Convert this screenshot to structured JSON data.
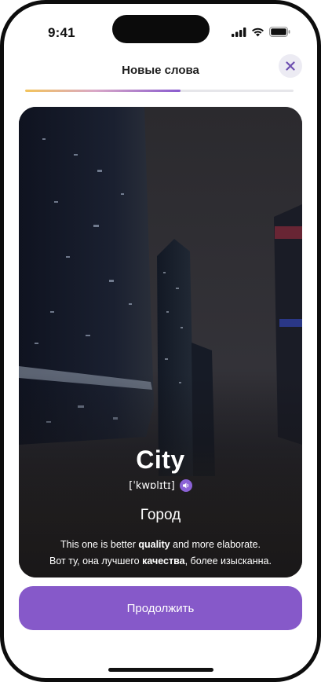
{
  "status_bar": {
    "time": "9:41",
    "icons": [
      "cellular-signal-icon",
      "wifi-icon",
      "battery-icon"
    ]
  },
  "header": {
    "title": "Новые слова",
    "close_icon": "close-icon"
  },
  "progress": {
    "fraction": 0.58,
    "gradient": [
      "#f3c45b",
      "#d9a8c7",
      "#8a5ccf"
    ]
  },
  "card": {
    "word": "City",
    "transcription": "[ˈkwɒlɪtɪ]",
    "audio_icon": "speaker-icon",
    "translation": "Город",
    "example_en": {
      "before": "This one is better ",
      "highlight": "quality",
      "after": " and more elaborate."
    },
    "example_ru": {
      "before": "Вот ту, она лучшего ",
      "highlight": "качества",
      "after": ", более изысканна."
    }
  },
  "cta": {
    "label": "Продолжить"
  },
  "colors": {
    "accent": "#8659c9",
    "close_bg": "#ecebf3",
    "text": "#1e1e1e"
  }
}
